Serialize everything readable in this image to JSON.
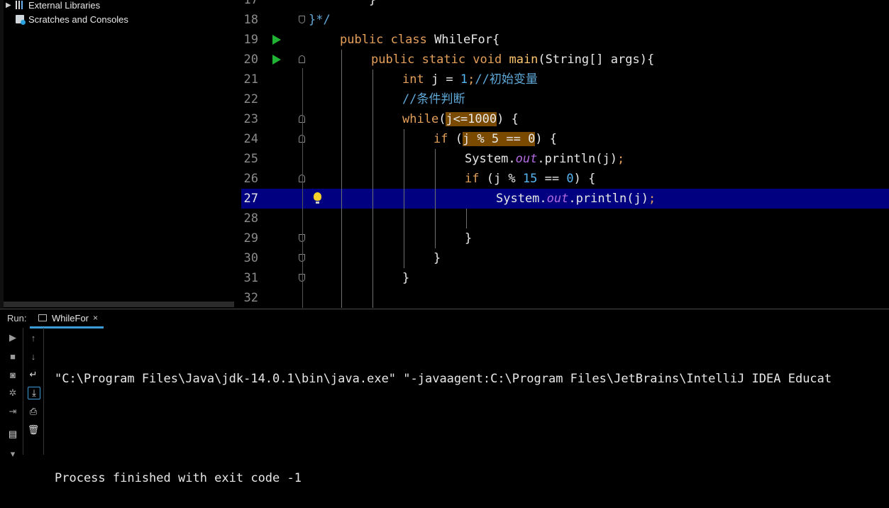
{
  "project_tree": {
    "items": [
      {
        "label": "External Libraries",
        "icon": "library-icon",
        "expandable": true
      },
      {
        "label": "Scratches and Consoles",
        "icon": "scratches-icon",
        "expandable": false
      }
    ]
  },
  "editor": {
    "current_line": 27,
    "lines": [
      {
        "num": "17",
        "text": "    }"
      },
      {
        "num": "18",
        "text": "}*/"
      },
      {
        "num": "19",
        "text": "public class WhileFor{",
        "run_icon": true
      },
      {
        "num": "20",
        "text": "public static void main(String[] args){",
        "run_icon": true
      },
      {
        "num": "21",
        "text": "int j = 1;//初始变量"
      },
      {
        "num": "22",
        "text": "//条件判断"
      },
      {
        "num": "23",
        "text": "while(j<=1000) {"
      },
      {
        "num": "24",
        "text": "if (j % 5 == 0) {"
      },
      {
        "num": "25",
        "text": "System.out.println(j);"
      },
      {
        "num": "26",
        "text": "if (j % 15 == 0) {"
      },
      {
        "num": "27",
        "text": "System.out.println(j);",
        "intention_bulb": true
      },
      {
        "num": "28",
        "text": ""
      },
      {
        "num": "29",
        "text": "}"
      },
      {
        "num": "30",
        "text": "}"
      },
      {
        "num": "31",
        "text": "}"
      },
      {
        "num": "32",
        "text": ""
      }
    ]
  },
  "run_window": {
    "label": "Run:",
    "tab_label": "WhileFor",
    "tab_close": "×",
    "console_lines": [
      "\"C:\\Program Files\\Java\\jdk-14.0.1\\bin\\java.exe\" \"-javaagent:C:\\Program Files\\JetBrains\\IntelliJ IDEA Educat",
      "",
      "Process finished with exit code -1"
    ]
  },
  "colors": {
    "keyword": "#e4a05a",
    "method": "#ffc66d",
    "number": "#56b6f2",
    "comment": "#5fa8d8",
    "static_field": "#b36ae0",
    "current_line_bg": "#000080",
    "search_highlight": "#7a4a00",
    "run_gutter_icon": "#21b333"
  }
}
